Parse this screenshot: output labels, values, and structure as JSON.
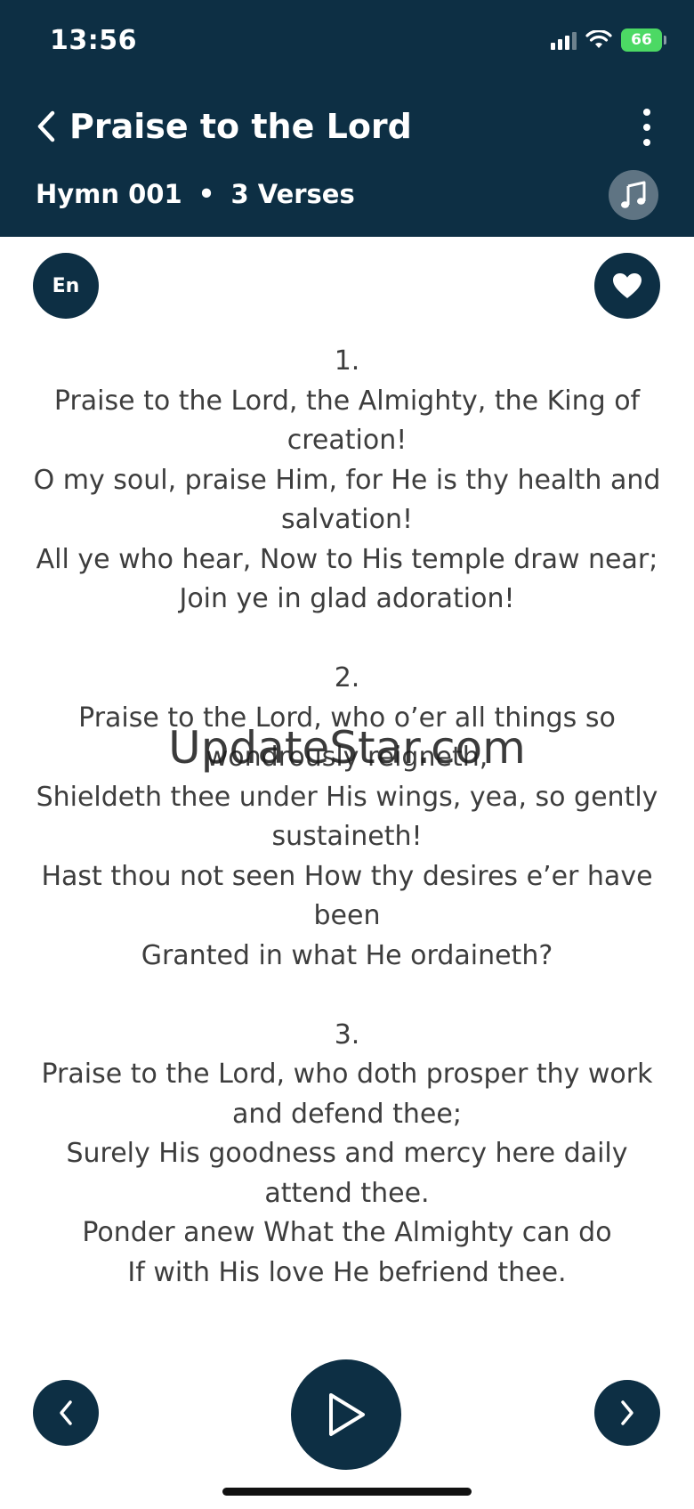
{
  "status_bar": {
    "time": "13:56",
    "battery": "66"
  },
  "header": {
    "title": "Praise to the Lord",
    "hymn_number": "Hymn 001",
    "separator": "•",
    "verse_count": "3 Verses"
  },
  "controls": {
    "language_label": "En"
  },
  "verses": [
    {
      "number": "1.",
      "lines": [
        "Praise to the Lord, the Almighty, the King of creation!",
        "O my soul, praise Him, for He is thy health and salvation!",
        "All ye who hear, Now to His temple draw near;",
        "Join ye in glad adoration!"
      ]
    },
    {
      "number": "2.",
      "lines": [
        "Praise to the Lord, who o’er all things so wondrously reigneth,",
        "Shieldeth thee under His wings, yea, so gently sustaineth!",
        "Hast thou not seen How thy desires e’er have been",
        "Granted in what He ordaineth?"
      ]
    },
    {
      "number": "3.",
      "lines": [
        "Praise to the Lord, who doth prosper thy work and defend thee;",
        "Surely His goodness and mercy here daily attend thee.",
        "Ponder anew What the Almighty can do",
        "If with His love He befriend thee."
      ]
    }
  ],
  "watermark": "UpdateStar.com",
  "icons": {
    "back": "chevron-left-icon",
    "more": "more-vertical-icon",
    "music": "music-note-icon",
    "favorite": "heart-icon",
    "previous": "chevron-left-icon",
    "play": "play-icon",
    "next": "chevron-right-icon"
  },
  "colors": {
    "primary": "#0d2f44",
    "battery": "#4cd964",
    "text": "#3d3d3d"
  }
}
